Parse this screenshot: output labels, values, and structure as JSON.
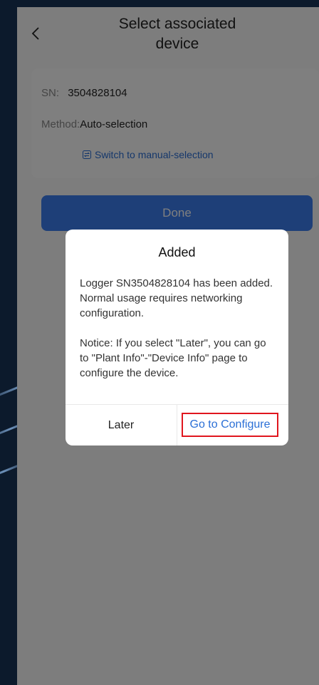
{
  "header": {
    "title": "Select associated device",
    "back_icon": "chevron-left-icon"
  },
  "card": {
    "sn_label": "SN:",
    "sn_value": "3504828104",
    "method_label": "Method:",
    "method_value": "Auto-selection",
    "switch_label": "Switch to manual-selection",
    "switch_icon": "swap-icon"
  },
  "done_label": "Done",
  "dialog": {
    "title": "Added",
    "message": "Logger SN3504828104 has been added. Normal usage requires networking configuration.",
    "notice": "Notice: If you select \"Later\", you can go to \"Plant Info\"-\"Device Info\" page to configure the device.",
    "later_label": "Later",
    "configure_label": "Go to Configure"
  },
  "colors": {
    "accent": "#3d7ff0",
    "link": "#2b6fd6",
    "highlight": "#e0161e"
  }
}
